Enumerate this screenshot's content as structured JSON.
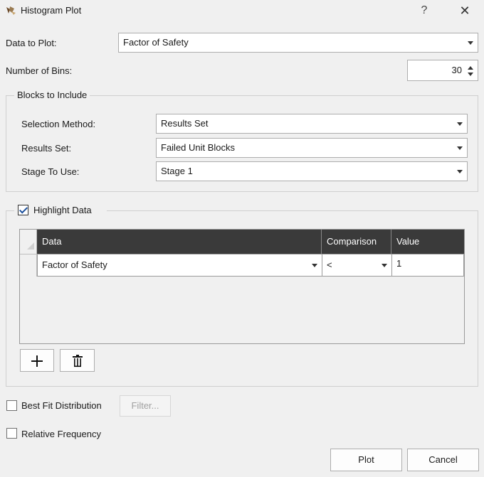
{
  "window": {
    "title": "Histogram Plot",
    "help_label": "?",
    "close_label": "✕"
  },
  "data_to_plot": {
    "label": "Data to Plot:",
    "value": "Factor of Safety"
  },
  "number_of_bins": {
    "label": "Number of Bins:",
    "value": "30"
  },
  "blocks_group": {
    "title": "Blocks to Include",
    "selection_method": {
      "label": "Selection Method:",
      "value": "Results Set"
    },
    "results_set": {
      "label": "Results Set:",
      "value": "Failed Unit Blocks"
    },
    "stage_to_use": {
      "label": "Stage To Use:",
      "value": "Stage 1"
    }
  },
  "highlight_group": {
    "title": "Highlight Data",
    "checked": true,
    "table": {
      "columns": [
        "Data",
        "Comparison",
        "Value"
      ],
      "rows": [
        {
          "data": "Factor of Safety",
          "comparison": "<",
          "value": "1"
        }
      ]
    },
    "add_icon": "plus-icon",
    "delete_icon": "trash-icon"
  },
  "best_fit": {
    "label": "Best Fit Distribution",
    "checked": false,
    "filter_button": "Filter..."
  },
  "relative_frequency": {
    "label": "Relative Frequency",
    "checked": false
  },
  "footer": {
    "plot_button": "Plot",
    "cancel_button": "Cancel"
  }
}
